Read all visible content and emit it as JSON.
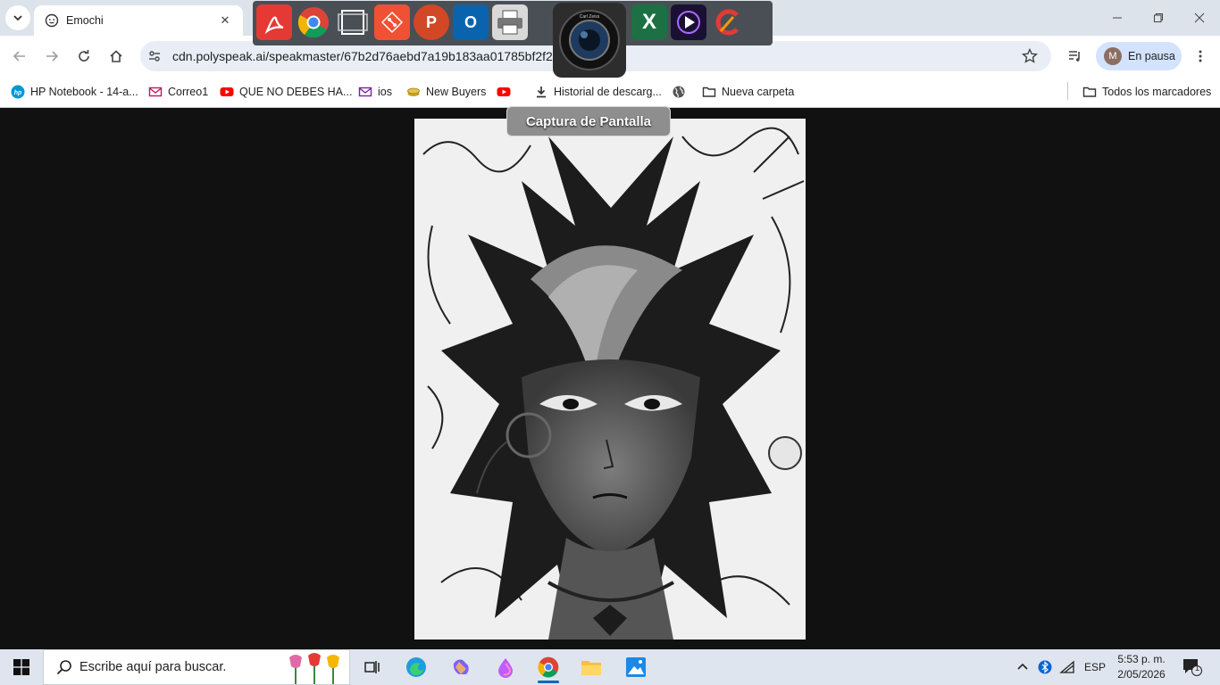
{
  "browser": {
    "active_tab_title": "Emochi",
    "address": "cdn.polyspeak.ai/speakmaster/67b2d76aebd7a19b183aa01785bf2f2",
    "profile_initial": "M",
    "profile_status": "En pausa"
  },
  "bookmarks": [
    {
      "label": "HP Notebook - 14-a...",
      "icon": "hp-icon"
    },
    {
      "label": "Correo1",
      "icon": "mail-icon"
    },
    {
      "label": "QUE NO DEBES HA...",
      "icon": "youtube-icon"
    },
    {
      "label": "ios",
      "icon": "mail-icon"
    },
    {
      "label": "New Buyers",
      "icon": "coins-icon"
    },
    {
      "label": "",
      "icon": "youtube-icon"
    },
    {
      "label": "Historial de descarg...",
      "icon": "download-icon"
    },
    {
      "label": "",
      "icon": "globe-icon"
    },
    {
      "label": "Nueva carpeta",
      "icon": "folder-icon"
    }
  ],
  "all_bookmarks_label": "Todos los marcadores",
  "dock": {
    "tooltip": "Captura de Pantalla",
    "lens_brand": "Carl Zeiss",
    "apps": [
      "adobe-reader-icon",
      "chrome-icon",
      "screen-capture-icon",
      "git-icon",
      "powerpoint-icon",
      "outlook-icon",
      "printer-icon",
      "camera-lens-icon",
      "excel-icon",
      "media-player-icon",
      "ccleaner-icon"
    ]
  },
  "taskbar": {
    "search_placeholder": "Escribe aquí para buscar.",
    "language": "ESP",
    "time": "5:53 p. m.",
    "date": "2/05/2026",
    "notification_count": "1"
  },
  "colors": {
    "chrome_bg": "#dde3ea",
    "omnibox_bg": "#e9eef6",
    "profile_bg": "#d3e3fd",
    "page_bg": "#111111",
    "accent": "#0067c0"
  }
}
